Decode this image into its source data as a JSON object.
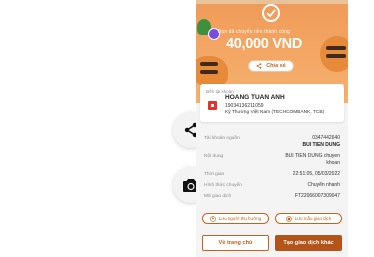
{
  "side_actions": {
    "share_icon": "share-icon",
    "camera_icon": "camera-icon"
  },
  "banner": {
    "subtitle": "Bạn đã chuyển tiền thành công",
    "amount": "40,000 VND",
    "share_label": "Chia sẻ"
  },
  "recipient": {
    "label": "Đến tài khoản",
    "name": "HOANG TUAN ANH",
    "account": "19034136211059",
    "bank": "Kỹ Thương Việt Nam (TECHCOMBANK, TCB)"
  },
  "details": {
    "source_label": "Tài khoản nguồn",
    "source_account": "0347442640",
    "source_name": "BUI TIEN DUNG",
    "content_label": "Nội dung",
    "content_value_1": "BUI TIEN DUNG chuyen",
    "content_value_2": "khoan",
    "time_label": "Thời gian",
    "time_value": "22:51:05, 05/03/2022",
    "method_label": "Hình thức chuyển",
    "method_value": "Chuyển nhanh",
    "code_label": "Mã giao dịch",
    "code_value": "FT22066007309047"
  },
  "actions": {
    "save_beneficiary": "Lưu người thụ hưởng",
    "save_template": "Lưu mẫu giao dịch",
    "home": "Về trang chủ",
    "new_transaction": "Tạo giao dịch khác"
  },
  "colors": {
    "accent": "#c8611e",
    "banner": "#f4a765",
    "primary_button": "#b45418"
  }
}
